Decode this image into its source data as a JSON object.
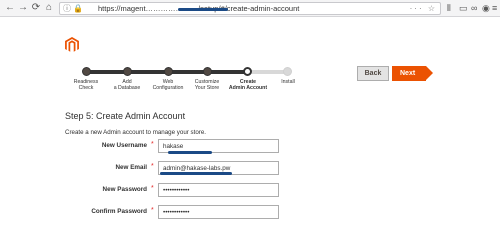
{
  "browser": {
    "url": "https://magent…………………/setup/#/create-admin-account"
  },
  "progress": {
    "steps": [
      {
        "label": "Readiness\nCheck"
      },
      {
        "label": "Add\na Database"
      },
      {
        "label": "Web\nConfiguration"
      },
      {
        "label": "Customize\nYour Store"
      },
      {
        "label": "Create\nAdmin Account"
      },
      {
        "label": "Install"
      }
    ],
    "current_step": 5,
    "back_label": "Back",
    "next_label": "Next"
  },
  "form": {
    "title": "Step 5: Create Admin Account",
    "intro": "Create a new Admin account to manage your store.",
    "fields": [
      {
        "label": "New Username",
        "value": "hakase",
        "required": "*"
      },
      {
        "label": "New Email",
        "value": "admin@hakase-labs.pw",
        "required": "*"
      },
      {
        "label": "New Password",
        "value": "••••••••••••",
        "required": "*"
      },
      {
        "label": "Confirm Password",
        "value": "••••••••••••",
        "required": "*"
      }
    ]
  },
  "colors": {
    "accent": "#eb5202",
    "track_done": "#333333",
    "required": "#e22626"
  }
}
